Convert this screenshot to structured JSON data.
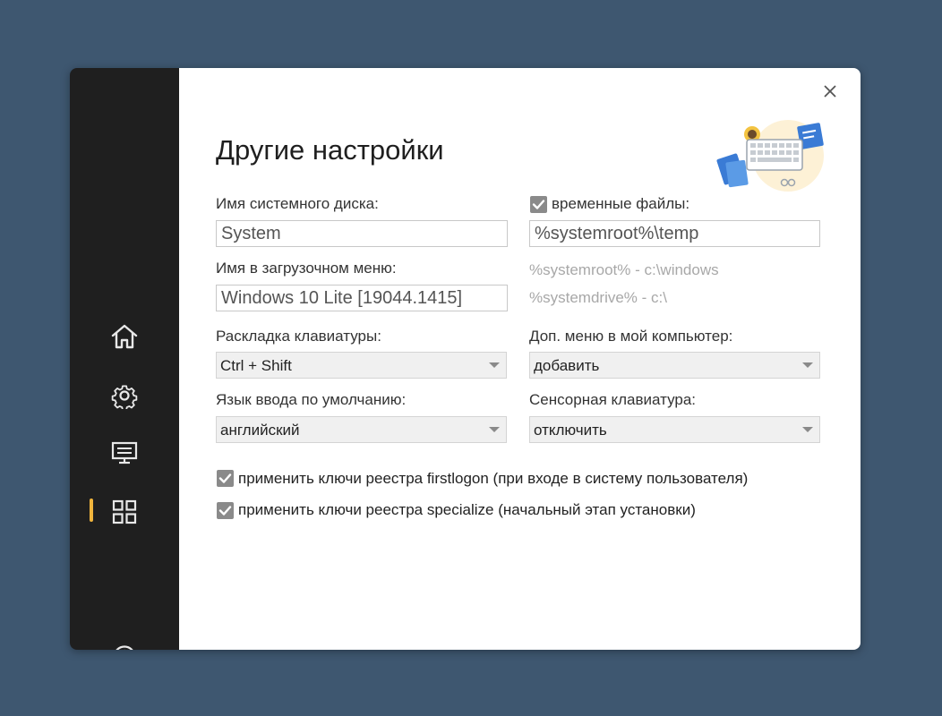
{
  "page": {
    "title": "Другие настройки"
  },
  "sidebar": {
    "items": [
      {
        "icon": "home-icon"
      },
      {
        "icon": "gear-icon"
      },
      {
        "icon": "monitor-icon"
      },
      {
        "icon": "apps-grid-icon",
        "active": true
      },
      {
        "icon": "help-icon"
      }
    ],
    "accent_color": "#f0b43c"
  },
  "form": {
    "system_disk_label": "Имя системного диска:",
    "system_disk_value": "System",
    "boot_menu_label": "Имя в загрузочном меню:",
    "boot_menu_value": "Windows 10 Lite [19044.1415]",
    "keyboard_layout_label": "Раскладка клавиатуры:",
    "keyboard_layout_value": "Ctrl + Shift",
    "input_lang_label": "Язык ввода по умолчанию:",
    "input_lang_value": "английский",
    "temp_files_label": "временные файлы:",
    "temp_files_checked": true,
    "temp_files_value": "%systemroot%\\temp",
    "hint_systemroot": "%systemroot%  - c:\\windows",
    "hint_systemdrive": "%systemdrive% - c:\\",
    "context_menu_label": "Доп. меню в мой компьютер:",
    "context_menu_value": "добавить",
    "touch_keyboard_label": "Сенсорная клавиатура:",
    "touch_keyboard_value": "отключить",
    "firstlogon_label": "применить ключи реестра firstlogon (при входе в систему пользователя)",
    "firstlogon_checked": true,
    "specialize_label": "применить ключи реестра specialize (начальный этап установки)",
    "specialize_checked": true
  },
  "colors": {
    "background": "#3e5770",
    "sidebar": "#1f1f1f",
    "checkbox": "#8a8a8a",
    "hint_text": "#a8a8a8"
  }
}
